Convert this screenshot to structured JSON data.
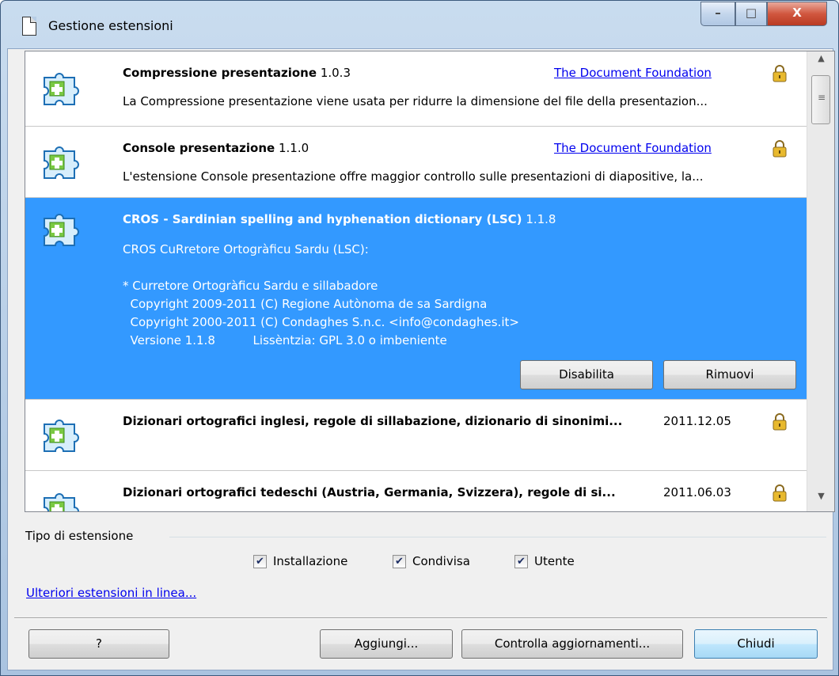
{
  "window": {
    "title": "Gestione estensioni",
    "min_label": "–",
    "max_label": "□",
    "close_label": "X"
  },
  "extensions": [
    {
      "name": "Compressione presentazione",
      "version": "1.0.3",
      "publisher": "The Document Foundation",
      "description": "La Compressione presentazione viene usata per ridurre la dimensione del file della presentazion...",
      "icon": "puzzle-icon",
      "locked": true
    },
    {
      "name": "Console presentazione",
      "version": "1.1.0",
      "publisher": "The Document Foundation",
      "description": "L'estensione Console presentazione offre maggior controllo sulle presentazioni di diapositive, la...",
      "icon": "puzzle-icon",
      "locked": true
    },
    {
      "name": "CROS - Sardinian spelling and hyphenation dictionary (LSC)",
      "version": "1.1.8",
      "description": "CROS CuRretore Ortogràficu Sardu (LSC):\n\n* Curretore Ortogràficu Sardu e sillabadore\n  Copyright 2009-2011 (C) Regione Autònoma de sa Sardigna\n  Copyright 2000-2011 (C) Condaghes S.n.c. <info@condaghes.it>\n  Versione 1.1.8          Lissèntzia: GPL 3.0 o imbeniente",
      "selected": true,
      "disable_label": "Disabilita",
      "remove_label": "Rimuovi",
      "icon": "puzzle-icon"
    },
    {
      "name": "Dizionari ortografici inglesi, regole di sillabazione, dizionario di sinonimi...",
      "version": "2011.12.05",
      "icon": "puzzle-icon",
      "locked": true
    },
    {
      "name": "Dizionari ortografici tedeschi (Austria, Germania, Svizzera), regole di si...",
      "version": "2011.06.03",
      "icon": "puzzle-icon",
      "locked": true
    }
  ],
  "filter": {
    "label": "Tipo di estensione",
    "installation": {
      "label": "Installazione",
      "checked": true
    },
    "shared": {
      "label": "Condivisa",
      "checked": true
    },
    "user": {
      "label": "Utente",
      "checked": true
    }
  },
  "more_link": "Ulteriori estensioni in linea...",
  "buttons": {
    "help": "?",
    "add": "Aggiungi...",
    "check_updates": "Controlla aggiornamenti...",
    "close": "Chiudi"
  }
}
